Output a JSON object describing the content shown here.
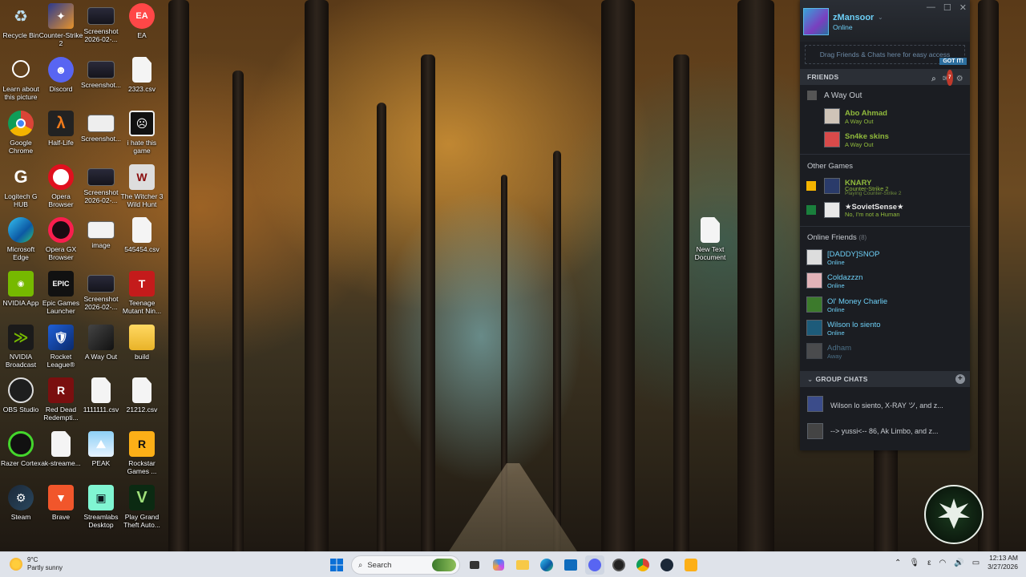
{
  "desktop": {
    "icons": [
      {
        "label": "Recycle Bin"
      },
      {
        "label": "Counter-Strike 2"
      },
      {
        "label": "Screenshot 2026-02-..."
      },
      {
        "label": "EA"
      },
      {
        "label": "Learn about this picture"
      },
      {
        "label": "Discord"
      },
      {
        "label": "Screenshot..."
      },
      {
        "label": "2323.csv"
      },
      {
        "label": "Google Chrome"
      },
      {
        "label": "Half-Life"
      },
      {
        "label": "Screenshot..."
      },
      {
        "label": "i hate this game"
      },
      {
        "label": "Logitech G HUB"
      },
      {
        "label": "Opera Browser"
      },
      {
        "label": "Screenshot 2026-02-..."
      },
      {
        "label": "The Witcher 3 Wild Hunt"
      },
      {
        "label": "Microsoft Edge"
      },
      {
        "label": "Opera GX Browser"
      },
      {
        "label": "image"
      },
      {
        "label": "545454.csv"
      },
      {
        "label": "NVIDIA App"
      },
      {
        "label": "Epic Games Launcher"
      },
      {
        "label": "Screenshot 2026-02-..."
      },
      {
        "label": "Teenage Mutant Nin..."
      },
      {
        "label": "NVIDIA Broadcast"
      },
      {
        "label": "Rocket League®"
      },
      {
        "label": "A Way Out"
      },
      {
        "label": "build"
      },
      {
        "label": "OBS Studio"
      },
      {
        "label": "Red Dead Redempti..."
      },
      {
        "label": "1111111.csv"
      },
      {
        "label": "21212.csv"
      },
      {
        "label": "Razer Cortex"
      },
      {
        "label": "ak-streame..."
      },
      {
        "label": "PEAK"
      },
      {
        "label": "Rockstar Games ..."
      },
      {
        "label": "Steam"
      },
      {
        "label": "Brave"
      },
      {
        "label": "Streamlabs Desktop"
      },
      {
        "label": "Play Grand Theft Auto..."
      },
      {
        "label": "New Text Document"
      }
    ]
  },
  "steam": {
    "username": "zMansoor",
    "status": "Online",
    "drag_hint": "Drag Friends & Chats here for easy access",
    "got_it": "GOT IT!",
    "friends_header": "FRIENDS",
    "notif_count": "7",
    "game_group": "A Way Out",
    "game_friends": [
      {
        "name": "Abo Ahmad",
        "status": "A Way Out"
      },
      {
        "name": "Sn4ke skins",
        "status": "A Way Out"
      }
    ],
    "other_games_label": "Other Games",
    "other_friends": [
      {
        "name": "KNARY",
        "status": "Counter-Strike 2",
        "sub": "Playing Counter-Strike 2"
      },
      {
        "name": "★SovietSense★",
        "status": "No, I'm not a Human",
        "sub": ""
      }
    ],
    "online_label": "Online Friends",
    "online_count": "(8)",
    "online_friends": [
      {
        "name": "[DADDY]SNOP",
        "status": "Online"
      },
      {
        "name": "Coldazzzn",
        "status": "Online"
      },
      {
        "name": "Ol' Money Charlie",
        "status": "Online"
      },
      {
        "name": "Wilson lo siento",
        "status": "Online"
      },
      {
        "name": "Adham",
        "status": "Away"
      }
    ],
    "group_chats_header": "GROUP CHATS",
    "group_chats": [
      {
        "text": "Wilson lo siento, X-RAY ツ, and z..."
      },
      {
        "text": "--> yussi<-- 86, Ak Limbo, and z..."
      }
    ]
  },
  "taskbar": {
    "temperature": "9°C",
    "weather": "Partly sunny",
    "search_placeholder": "Search",
    "time": "12:13 AM",
    "date": "3/27/2026"
  },
  "colors": {
    "steam_bg": "#1b1d22",
    "in_game_green": "#90ba3c",
    "online_blue": "#6dcff6",
    "taskbar_bg": "#dfe3ea"
  }
}
